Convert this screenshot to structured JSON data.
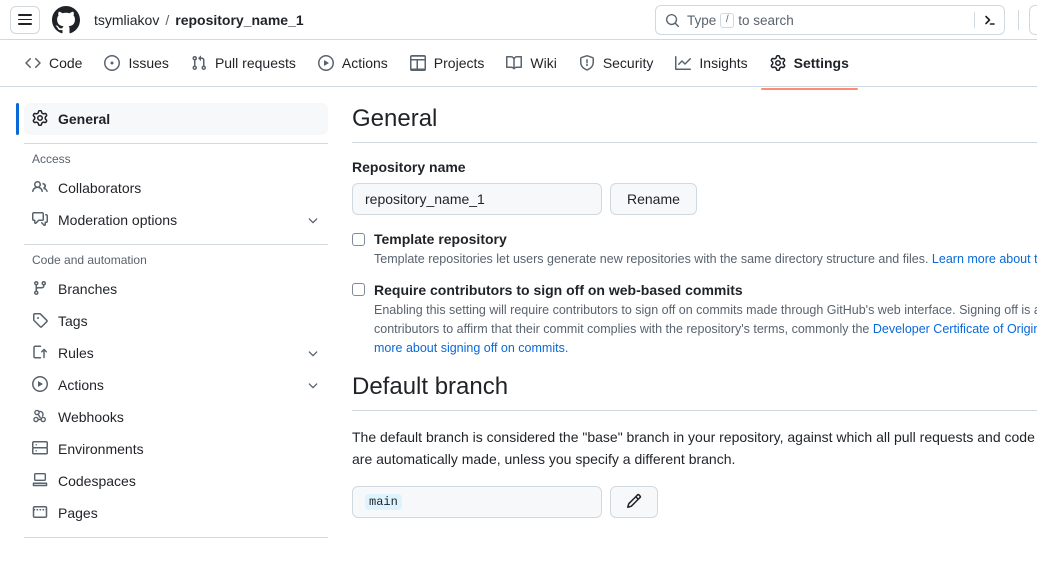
{
  "header": {
    "menu_icon": "hamburger-icon",
    "logo_icon": "github-logo-icon",
    "owner": "tsymliakov",
    "separator": "/",
    "repo": "repository_name_1",
    "search": {
      "icon": "search-icon",
      "placeholder_before": "Type",
      "slash_key": "/",
      "placeholder_after": "to search",
      "terminal_icon": "terminal-icon"
    }
  },
  "repo_nav": {
    "tabs": [
      {
        "label": "Code",
        "icon": "code-icon",
        "active": false
      },
      {
        "label": "Issues",
        "icon": "issue-opened-icon",
        "active": false
      },
      {
        "label": "Pull requests",
        "icon": "git-pull-request-icon",
        "active": false
      },
      {
        "label": "Actions",
        "icon": "play-icon",
        "active": false
      },
      {
        "label": "Projects",
        "icon": "table-icon",
        "active": false
      },
      {
        "label": "Wiki",
        "icon": "book-icon",
        "active": false
      },
      {
        "label": "Security",
        "icon": "shield-icon",
        "active": false
      },
      {
        "label": "Insights",
        "icon": "graph-icon",
        "active": false
      },
      {
        "label": "Settings",
        "icon": "gear-icon",
        "active": true
      }
    ],
    "active_underline_color": "#fd8c73"
  },
  "sidebar": {
    "active_indicator_color": "#0969da",
    "general": {
      "label": "General",
      "icon": "gear-icon"
    },
    "sections": [
      {
        "title": "Access",
        "items": [
          {
            "label": "Collaborators",
            "icon": "people-icon",
            "expandable": false
          },
          {
            "label": "Moderation options",
            "icon": "comment-discussion-icon",
            "expandable": true
          }
        ]
      },
      {
        "title": "Code and automation",
        "items": [
          {
            "label": "Branches",
            "icon": "git-branch-icon",
            "expandable": false
          },
          {
            "label": "Tags",
            "icon": "tag-icon",
            "expandable": false
          },
          {
            "label": "Rules",
            "icon": "rules-icon",
            "expandable": true
          },
          {
            "label": "Actions",
            "icon": "play-icon",
            "expandable": true
          },
          {
            "label": "Webhooks",
            "icon": "webhook-icon",
            "expandable": false
          },
          {
            "label": "Environments",
            "icon": "server-icon",
            "expandable": false
          },
          {
            "label": "Codespaces",
            "icon": "codespaces-icon",
            "expandable": false
          },
          {
            "label": "Pages",
            "icon": "browser-icon",
            "expandable": false
          }
        ]
      }
    ]
  },
  "main": {
    "title": "General",
    "repository_name": {
      "label": "Repository name",
      "value": "repository_name_1",
      "rename_button": "Rename"
    },
    "template_repository": {
      "checked": false,
      "label": "Template repository",
      "description": "Template repositories let users generate new repositories with the same directory structure and files.",
      "link_text": "Learn more about template repositories."
    },
    "sign_off": {
      "checked": false,
      "label": "Require contributors to sign off on web-based commits",
      "description_part1": "Enabling this setting will require contributors to sign off on commits made through GitHub's web interface. Signing off is a way for contributors to affirm that their commit complies with the repository's terms, commonly the ",
      "link1_text": "Developer Certificate of Origin (DCO)",
      "description_part2": ". ",
      "link2_text": "Learn more about signing off on commits."
    },
    "default_branch": {
      "title": "Default branch",
      "description": "The default branch is considered the \"base\" branch in your repository, against which all pull requests and code commits are automatically made, unless you specify a different branch.",
      "value": "main",
      "edit_icon": "pencil-icon"
    }
  }
}
